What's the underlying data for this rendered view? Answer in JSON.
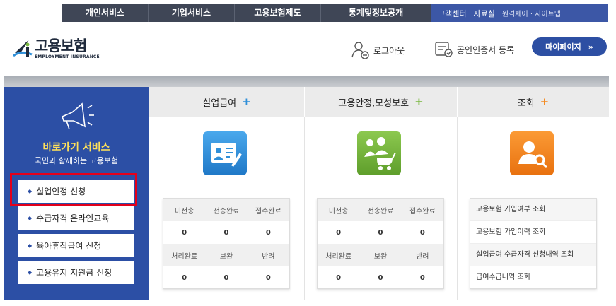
{
  "topnav": {
    "items": [
      "개인서비스",
      "기업서비스",
      "고용보험제도",
      "통계및정보공개"
    ],
    "customer": "고객센터",
    "resources": "자료실",
    "remote": "원격제어 · 사이트맵"
  },
  "header": {
    "logo_kr": "고용보험",
    "logo_en": "EMPLOYMENT INSURANCE",
    "logout": "로그아웃",
    "cert": "공인인증서 등록",
    "mypage": "마이페이지"
  },
  "sidebar": {
    "title": "바로가기 서비스",
    "subtitle": "국민과 함께하는 고용보험",
    "items": [
      "실업인정 신청",
      "수급자격 온라인교육",
      "육아휴직급여 신청",
      "고용유지 지원금 신청"
    ]
  },
  "columns": [
    {
      "title": "실업급여",
      "plus": "+",
      "accent": "#2f8fd8",
      "headers1": [
        "미전송",
        "전송완료",
        "접수완료"
      ],
      "values1": [
        "0",
        "0",
        "0"
      ],
      "headers2": [
        "처리완료",
        "보완",
        "반려"
      ],
      "values2": [
        "0",
        "0",
        "0"
      ]
    },
    {
      "title": "고용안정,모성보호",
      "plus": "+",
      "accent": "#7ab840",
      "headers1": [
        "미전송",
        "전송완료",
        "접수완료"
      ],
      "values1": [
        "0",
        "0",
        "0"
      ],
      "headers2": [
        "처리완료",
        "보완",
        "반려"
      ],
      "values2": [
        "0",
        "0",
        "0"
      ]
    },
    {
      "title": "조회",
      "plus": "+",
      "accent": "#f58a1f",
      "links": [
        "고용보험 가입여부 조회",
        "고용보험 가입이력 조회",
        "실업급여 수급자격 신청내역 조회",
        "급여수급내역 조회"
      ]
    }
  ]
}
